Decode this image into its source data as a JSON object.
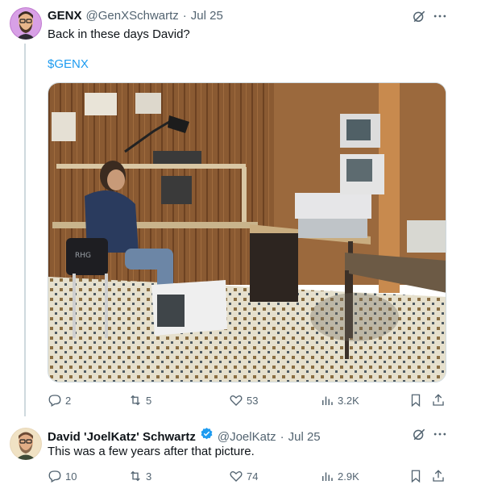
{
  "tweets": [
    {
      "display_name": "GENX",
      "handle": "@GenXSchwartz",
      "separator": "·",
      "date": "Jul 25",
      "text": "Back in these days David?",
      "cashtag": "$GENX",
      "stats": {
        "replies": "2",
        "retweets": "5",
        "likes": "53",
        "views": "3.2K"
      }
    },
    {
      "display_name": "David 'JoelKatz' Schwartz",
      "handle": "@JoelKatz",
      "separator": "·",
      "date": "Jul 25",
      "text": "This was a few years after that picture.",
      "stats": {
        "replies": "10",
        "retweets": "3",
        "likes": "74",
        "views": "2.9K"
      }
    }
  ],
  "media_watermark": "RHG",
  "colors": {
    "link": "#1d9bf0",
    "muted": "#536471",
    "verified": "#1d9bf0",
    "thread_line": "#cfd9de"
  },
  "icons": [
    "grok-icon",
    "more-icon",
    "reply-icon",
    "retweet-icon",
    "like-icon",
    "views-icon",
    "bookmark-icon",
    "share-icon",
    "verified-badge-icon"
  ]
}
